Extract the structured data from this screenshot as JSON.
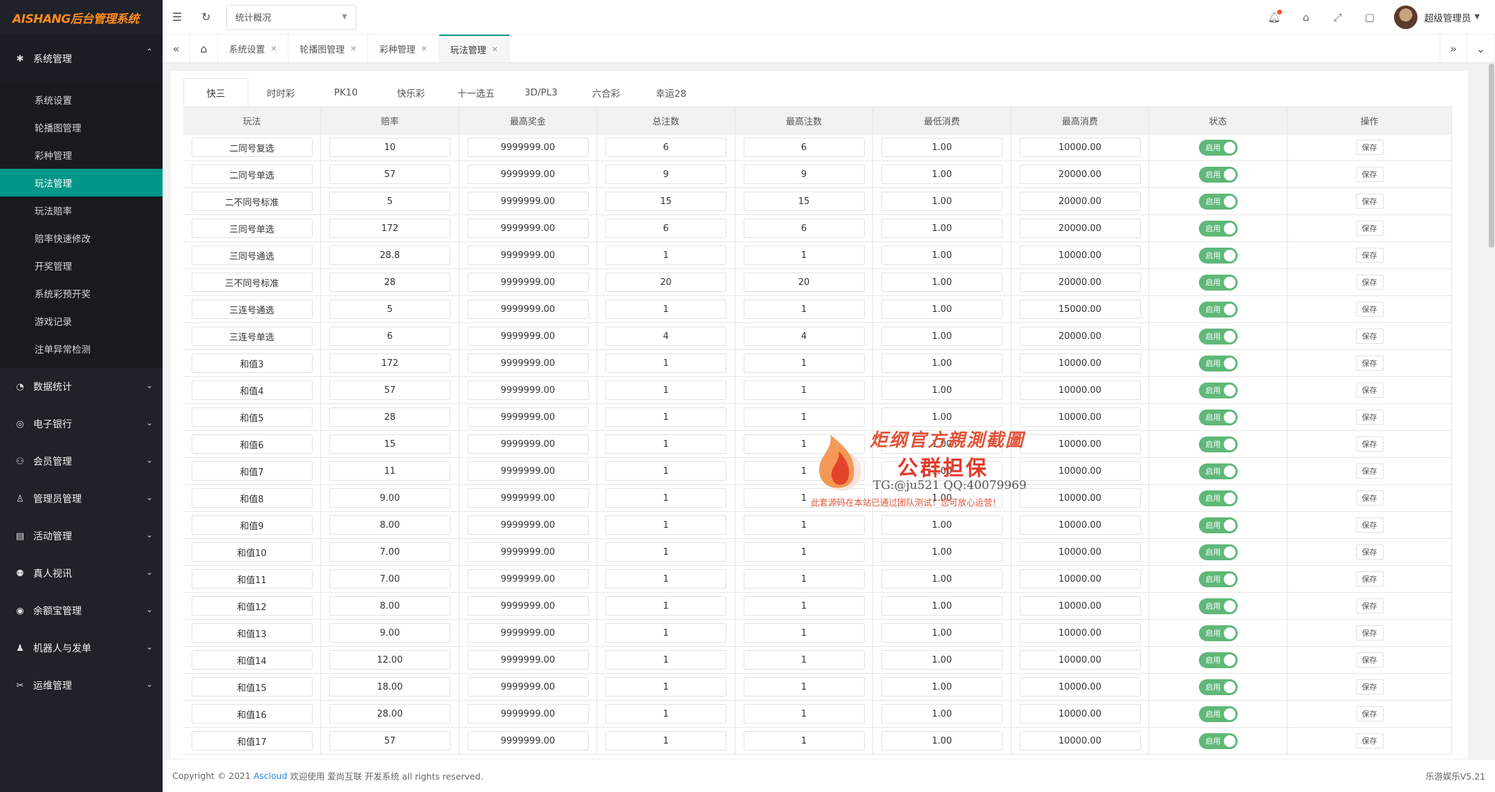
{
  "app": {
    "logo": "AISHANG后台管理系统"
  },
  "sidebar": {
    "groups": [
      {
        "label": "系统管理",
        "icon": "gear-icon",
        "open": true,
        "items": [
          "系统设置",
          "轮播图管理",
          "彩种管理",
          "玩法管理",
          "玩法赔率",
          "赔率快速修改",
          "开奖管理",
          "系统彩预开奖",
          "游戏记录",
          "注单异常检测"
        ],
        "active": "玩法管理"
      },
      {
        "label": "数据统计",
        "icon": "dashboard-icon"
      },
      {
        "label": "电子银行",
        "icon": "coin-icon"
      },
      {
        "label": "会员管理",
        "icon": "users-icon"
      },
      {
        "label": "管理员管理",
        "icon": "user-icon"
      },
      {
        "label": "活动管理",
        "icon": "card-icon"
      },
      {
        "label": "真人视讯",
        "icon": "group-icon"
      },
      {
        "label": "余额宝管理",
        "icon": "piggy-icon"
      },
      {
        "label": "机器人与发单",
        "icon": "robot-icon"
      },
      {
        "label": "运维管理",
        "icon": "tools-icon"
      }
    ]
  },
  "topbar": {
    "select_value": "统计概况",
    "username": "超级管理员"
  },
  "page_tabs": [
    {
      "label": "系统设置"
    },
    {
      "label": "轮播图管理"
    },
    {
      "label": "彩种管理"
    },
    {
      "label": "玩法管理",
      "active": true
    }
  ],
  "lottery_tabs": [
    "快三",
    "时时彩",
    "PK10",
    "快乐彩",
    "十一选五",
    "3D/PL3",
    "六合彩",
    "幸运28"
  ],
  "lottery_tab_active": "快三",
  "table": {
    "headers": [
      "玩法",
      "赔率",
      "最高奖金",
      "总注数",
      "最高注数",
      "最低消费",
      "最高消费",
      "状态",
      "操作"
    ],
    "status_label": "启用",
    "save_label": "保存",
    "rows": [
      [
        "二同号复选",
        "10",
        "9999999.00",
        "6",
        "6",
        "1.00",
        "10000.00"
      ],
      [
        "二同号单选",
        "57",
        "9999999.00",
        "9",
        "9",
        "1.00",
        "20000.00"
      ],
      [
        "二不同号标准",
        "5",
        "9999999.00",
        "15",
        "15",
        "1.00",
        "20000.00"
      ],
      [
        "三同号单选",
        "172",
        "9999999.00",
        "6",
        "6",
        "1.00",
        "20000.00"
      ],
      [
        "三同号通选",
        "28.8",
        "9999999.00",
        "1",
        "1",
        "1.00",
        "10000.00"
      ],
      [
        "三不同号标准",
        "28",
        "9999999.00",
        "20",
        "20",
        "1.00",
        "20000.00"
      ],
      [
        "三连号通选",
        "5",
        "9999999.00",
        "1",
        "1",
        "1.00",
        "15000.00"
      ],
      [
        "三连号单选",
        "6",
        "9999999.00",
        "4",
        "4",
        "1.00",
        "20000.00"
      ],
      [
        "和值3",
        "172",
        "9999999.00",
        "1",
        "1",
        "1.00",
        "10000.00"
      ],
      [
        "和值4",
        "57",
        "9999999.00",
        "1",
        "1",
        "1.00",
        "10000.00"
      ],
      [
        "和值5",
        "28",
        "9999999.00",
        "1",
        "1",
        "1.00",
        "10000.00"
      ],
      [
        "和值6",
        "15",
        "9999999.00",
        "1",
        "1",
        "1.00",
        "10000.00"
      ],
      [
        "和值7",
        "11",
        "9999999.00",
        "1",
        "1",
        "1.00",
        "10000.00"
      ],
      [
        "和值8",
        "9.00",
        "9999999.00",
        "1",
        "1",
        "1.00",
        "10000.00"
      ],
      [
        "和值9",
        "8.00",
        "9999999.00",
        "1",
        "1",
        "1.00",
        "10000.00"
      ],
      [
        "和值10",
        "7.00",
        "9999999.00",
        "1",
        "1",
        "1.00",
        "10000.00"
      ],
      [
        "和值11",
        "7.00",
        "9999999.00",
        "1",
        "1",
        "1.00",
        "10000.00"
      ],
      [
        "和值12",
        "8.00",
        "9999999.00",
        "1",
        "1",
        "1.00",
        "10000.00"
      ],
      [
        "和值13",
        "9.00",
        "9999999.00",
        "1",
        "1",
        "1.00",
        "10000.00"
      ],
      [
        "和值14",
        "12.00",
        "9999999.00",
        "1",
        "1",
        "1.00",
        "10000.00"
      ],
      [
        "和值15",
        "18.00",
        "9999999.00",
        "1",
        "1",
        "1.00",
        "10000.00"
      ],
      [
        "和值16",
        "28.00",
        "9999999.00",
        "1",
        "1",
        "1.00",
        "10000.00"
      ],
      [
        "和值17",
        "57",
        "9999999.00",
        "1",
        "1",
        "1.00",
        "10000.00"
      ]
    ]
  },
  "watermark": {
    "line1": "炬纲官方親測截圖",
    "line2": "公群担保",
    "line3": "TG:@ju521   QQ:40079969",
    "line4": "此套源码在本站已通过团队测试！您可放心运营！"
  },
  "footer": {
    "copyright": "Copyright © 2021",
    "link": "Ascloud",
    "text": "欢迎使用 爱尚互联 开发系统 all rights reserved.",
    "version": "乐游娱乐V5.21"
  },
  "colors": {
    "sidebar_bg": "#20222a",
    "accent": "#009688",
    "switch_on": "#5fb878"
  }
}
